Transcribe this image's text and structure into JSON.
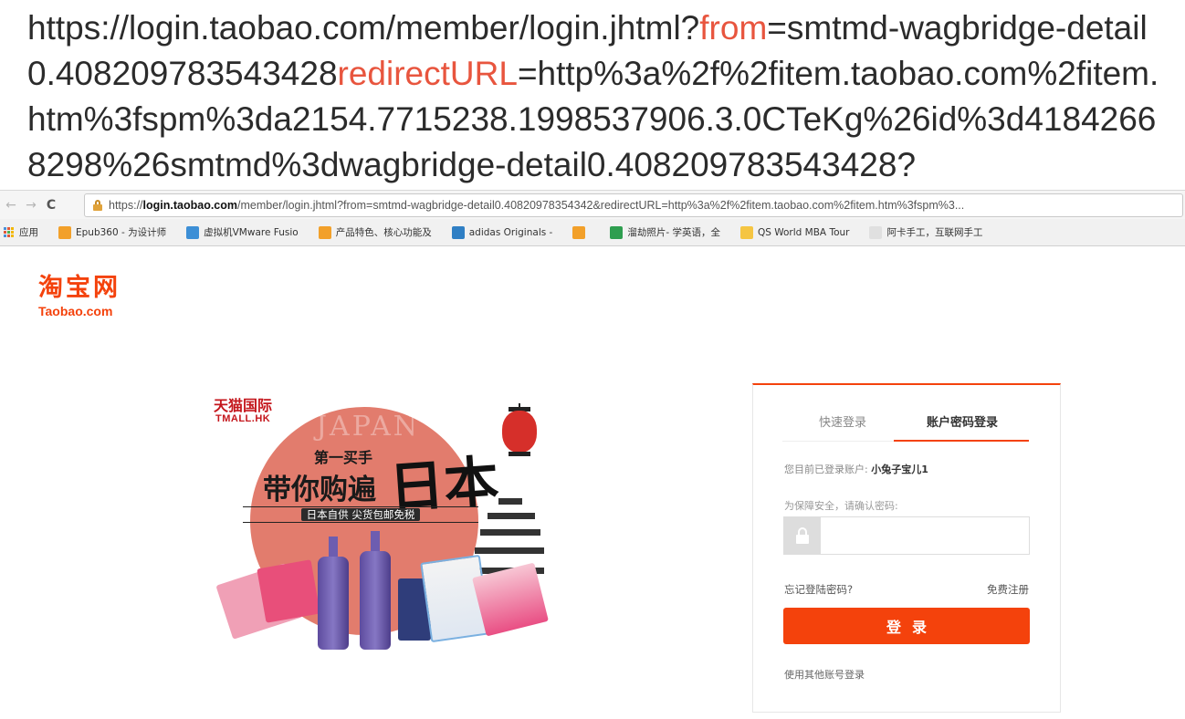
{
  "annotation": {
    "part1": "https://login.taobao.com/member/login.jhtml?",
    "param1": "from",
    "part2": "=smtmd-wagbridge-detail0.408209783543428",
    "param2": "redirectURL",
    "part3": "=http%3a%2f%2fitem.taobao.com%2fitem.htm%3fspm%3da2154.7715238.1998537906.3.0CTeKg%26id%3d41842668298%26smtmd%3dwagbridge-detail0.408209783543428?"
  },
  "browser": {
    "back_icon": "back-arrow-icon",
    "forward_icon": "forward-arrow-icon",
    "reload_icon": "reload-icon",
    "back_glyph": "←",
    "forward_glyph": "→",
    "reload_glyph": "C",
    "url_scheme": "https://",
    "url_host": "login.taobao.com",
    "url_rest": "/member/login.jhtml?from=smtmd-wagbridge-detail0.40820978354342&redirectURL=http%3a%2f%2fitem.taobao.com%2fitem.htm%3fspm%3..."
  },
  "bookmarks": [
    {
      "label": "应用",
      "color": "#4a90d9"
    },
    {
      "label": "Epub360 - 为设计师",
      "color": "#f2a02a"
    },
    {
      "label": "虚拟机VMware Fusio",
      "color": "#3d8fd6"
    },
    {
      "label": "产品特色、核心功能及",
      "color": "#f2a02a"
    },
    {
      "label": "adidas Originals - ",
      "color": "#2f7fc4"
    },
    {
      "label": "",
      "color": "#f2a02a"
    },
    {
      "label": "溜劫照片- 学英语，全",
      "color": "#2e9e4f"
    },
    {
      "label": "QS World MBA Tour",
      "color": "#f5c542"
    },
    {
      "label": "阿卡手工，互联网手工",
      "color": "#e0e0e0"
    }
  ],
  "logo": {
    "cn": "淘宝网",
    "en": "Taobao.com"
  },
  "promo": {
    "tmall_cn": "天猫国际",
    "tmall_en": "TMALL.HK",
    "watermark": "JAPAN",
    "line1": "第一买手",
    "line2": "带你购遍",
    "big": "日本",
    "band": "日本自供 尖货包邮免税"
  },
  "login": {
    "tab_quick": "快速登录",
    "tab_password": "账户密码登录",
    "account_prefix": "您目前已登录账户:",
    "account_name": "小兔子宝儿1",
    "security_tip": "为保障安全，请确认密码:",
    "password_value": "",
    "password_placeholder": "",
    "forgot_link": "忘记登陆密码?",
    "register_link": "免费注册",
    "login_button": "登录",
    "other_login": "使用其他账号登录",
    "accent_color": "#f4420c"
  }
}
